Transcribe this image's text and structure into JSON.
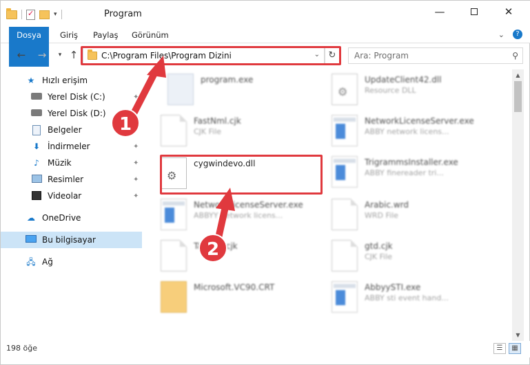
{
  "window": {
    "title": "Program"
  },
  "ribbon": {
    "tabs": [
      "Dosya",
      "Giriş",
      "Paylaş",
      "Görünüm"
    ]
  },
  "address": {
    "path": "C:\\Program Files\\Program Dizini"
  },
  "search": {
    "placeholder": "Ara: Program"
  },
  "sidebar": {
    "items": [
      {
        "label": "Hızlı erişim",
        "icon": "star-icon"
      },
      {
        "label": "Yerel Disk (C:)",
        "icon": "disk-icon"
      },
      {
        "label": "Yerel Disk (D:)",
        "icon": "disk-icon"
      },
      {
        "label": "Belgeler",
        "icon": "documents-icon"
      },
      {
        "label": "İndirmeler",
        "icon": "download-icon"
      },
      {
        "label": "Müzik",
        "icon": "music-icon"
      },
      {
        "label": "Resimler",
        "icon": "pictures-icon"
      },
      {
        "label": "Videolar",
        "icon": "videos-icon"
      },
      {
        "label": "OneDrive",
        "icon": "cloud-icon"
      },
      {
        "label": "Bu bilgisayar",
        "icon": "computer-icon"
      },
      {
        "label": "Ağ",
        "icon": "network-icon"
      }
    ]
  },
  "files": {
    "left": [
      {
        "name": "program.exe",
        "type": ""
      },
      {
        "name": "FastNml.cjk",
        "type": "CJK File"
      },
      {
        "name": "cygwindevo.dll",
        "type": ""
      },
      {
        "name": "NetworkLicenseServer.exe",
        "type": "ABBYY network licens..."
      },
      {
        "name": "Tab1en.cjk",
        "type": ""
      },
      {
        "name": "Microsoft.VC90.CRT",
        "type": ""
      }
    ],
    "right": [
      {
        "name": "UpdateClient42.dll",
        "type": "Resource DLL"
      },
      {
        "name": "NetworkLicenseServer.exe",
        "type": "ABBY network licens..."
      },
      {
        "name": "TrigrammsInstaller.exe",
        "type": "ABBY finereader tri..."
      },
      {
        "name": "Arabic.wrd",
        "type": "WRD File"
      },
      {
        "name": "gtd.cjk",
        "type": "CJK File"
      },
      {
        "name": "AbbyySTI.exe",
        "type": "ABBY sti event hand..."
      }
    ]
  },
  "status": {
    "count": "198 öğe"
  },
  "annotations": {
    "step1": "1",
    "step2": "2"
  },
  "colors": {
    "accent": "#1979ca",
    "highlight": "#e0393e",
    "selected": "#cce4f7"
  }
}
